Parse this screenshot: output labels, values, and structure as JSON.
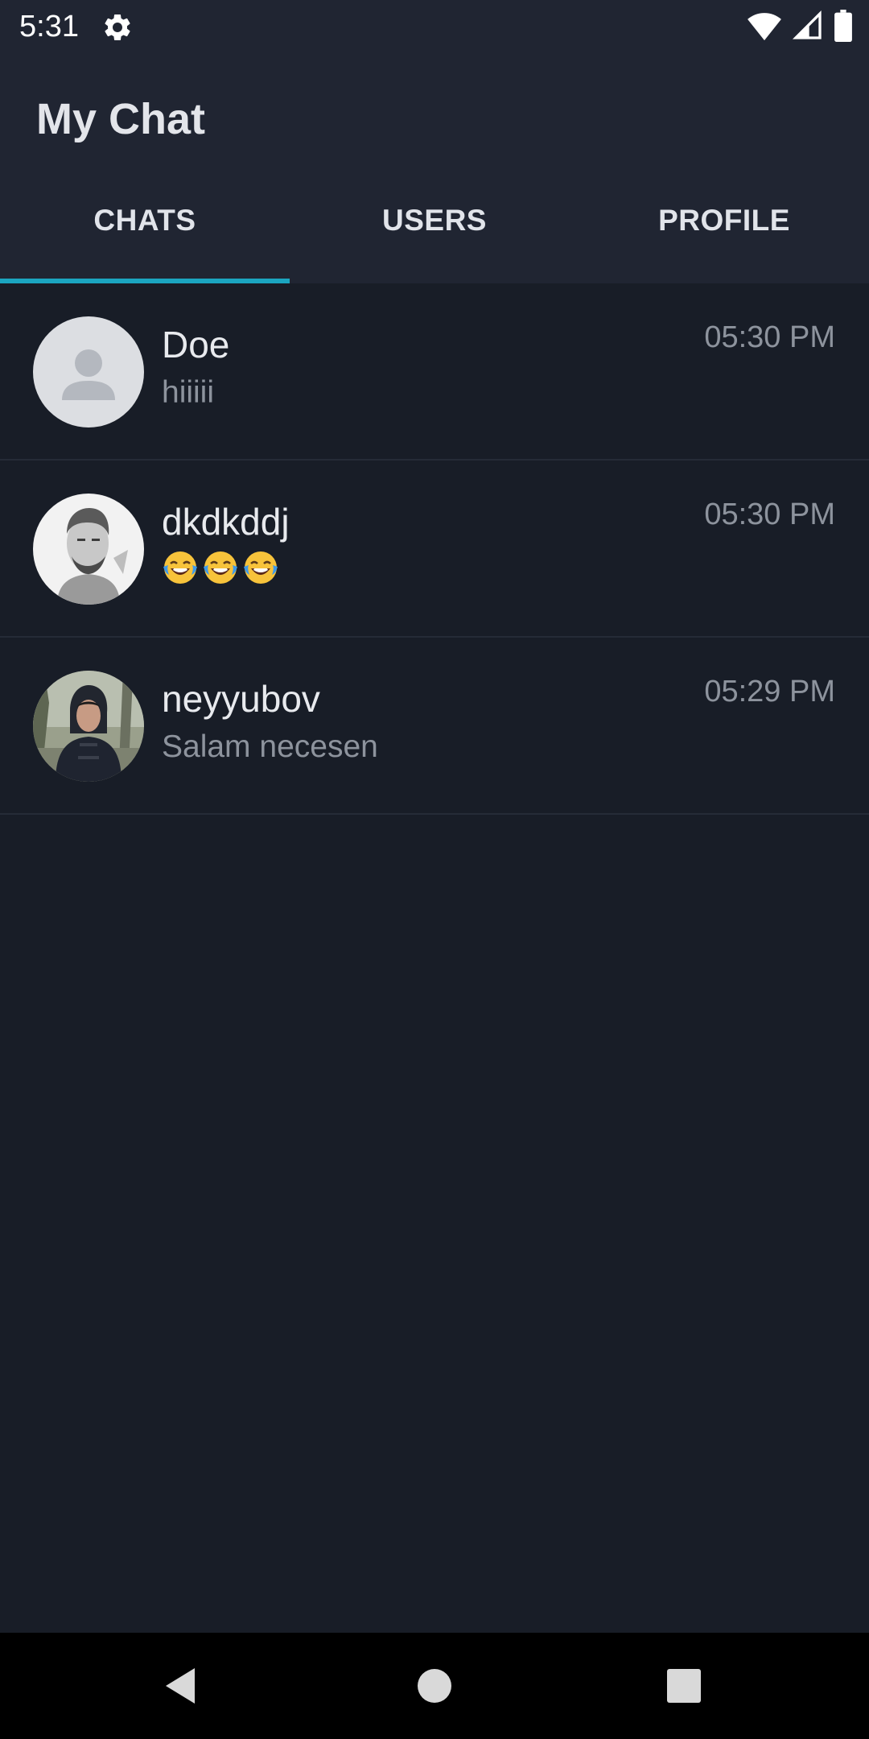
{
  "status_bar": {
    "time": "5:31",
    "icons": [
      "settings-icon",
      "wifi-icon",
      "cellular-signal-icon",
      "battery-icon"
    ]
  },
  "app_bar": {
    "title": "My Chat"
  },
  "tabs": [
    {
      "label": "CHATS",
      "selected": true
    },
    {
      "label": "USERS",
      "selected": false
    },
    {
      "label": "PROFILE",
      "selected": false
    }
  ],
  "colors": {
    "background": "#181d27",
    "app_bar": "#202532",
    "accent": "#1ba5c0",
    "secondary_text": "#8d939d"
  },
  "chats": [
    {
      "name": "Doe",
      "last_message": "hiiiii",
      "time": "05:30 PM",
      "avatar": "default-avatar-icon"
    },
    {
      "name": "dkdkddj",
      "last_message": "😂😂😂",
      "time": "05:30 PM",
      "avatar": "portrait-photo"
    },
    {
      "name": "neyyubov",
      "last_message": "Salam necesen",
      "time": "05:29 PM",
      "avatar": "outdoor-photo"
    }
  ],
  "nav_bar": {
    "icons": [
      "back-icon",
      "home-icon",
      "recents-icon"
    ]
  }
}
